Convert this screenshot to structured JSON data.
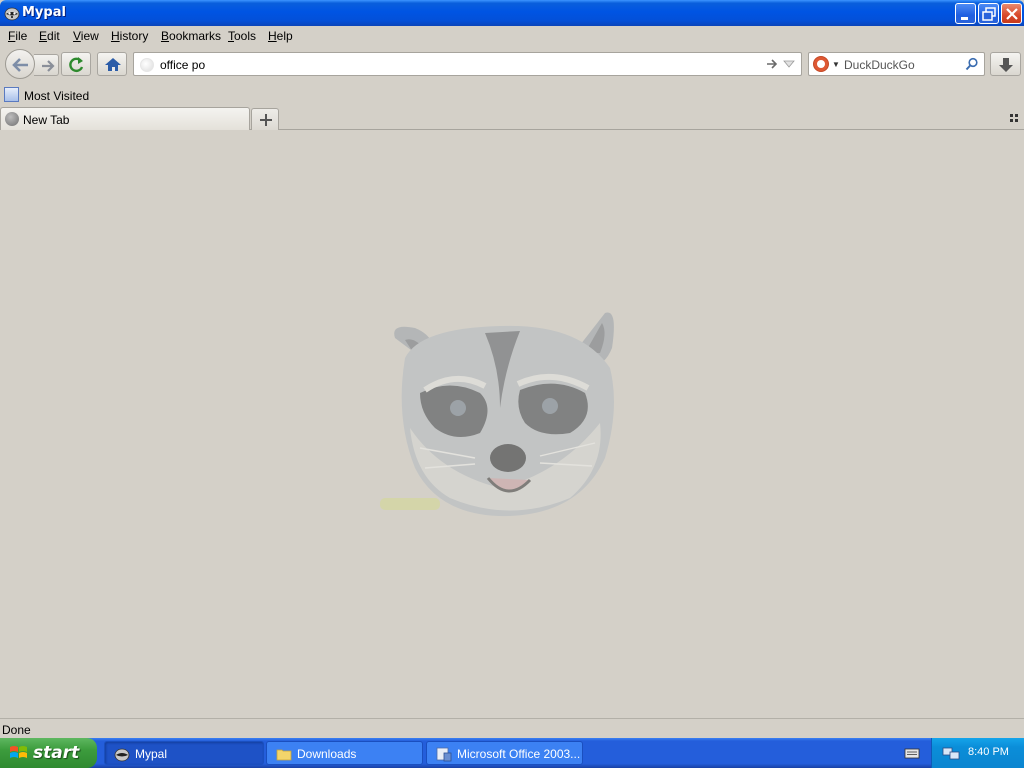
{
  "window": {
    "title": "Mypal"
  },
  "menubar": {
    "items": [
      {
        "label": "File",
        "accel": "F",
        "rest": "ile"
      },
      {
        "label": "Edit",
        "accel": "E",
        "rest": "dit"
      },
      {
        "label": "View",
        "accel": "V",
        "rest": "iew"
      },
      {
        "label": "History",
        "accel": "H",
        "rest": "istory"
      },
      {
        "label": "Bookmarks",
        "accel": "B",
        "rest": "ookmarks"
      },
      {
        "label": "Tools",
        "accel": "T",
        "rest": "ools"
      },
      {
        "label": "Help",
        "accel": "H",
        "rest": "elp"
      }
    ]
  },
  "navbar": {
    "url_value": "office po",
    "search_placeholder": "DuckDuckGo"
  },
  "bookmarks": {
    "items": [
      {
        "label": "Most Visited"
      }
    ]
  },
  "tabs": [
    {
      "label": "New Tab",
      "active": true
    }
  ],
  "status": {
    "text": "Done"
  },
  "taskbar": {
    "start_label": "start",
    "tasks": [
      {
        "label": "Mypal",
        "active": true
      },
      {
        "label": "Downloads",
        "active": false
      },
      {
        "label": "Microsoft Office 2003...",
        "active": false
      }
    ],
    "clock": "8:40 PM"
  },
  "colors": {
    "titlebar": "#0054e3",
    "chrome": "#d4d0c8",
    "taskbar": "#245edb",
    "start": "#3c9c3d",
    "tray": "#0b8ed9"
  }
}
